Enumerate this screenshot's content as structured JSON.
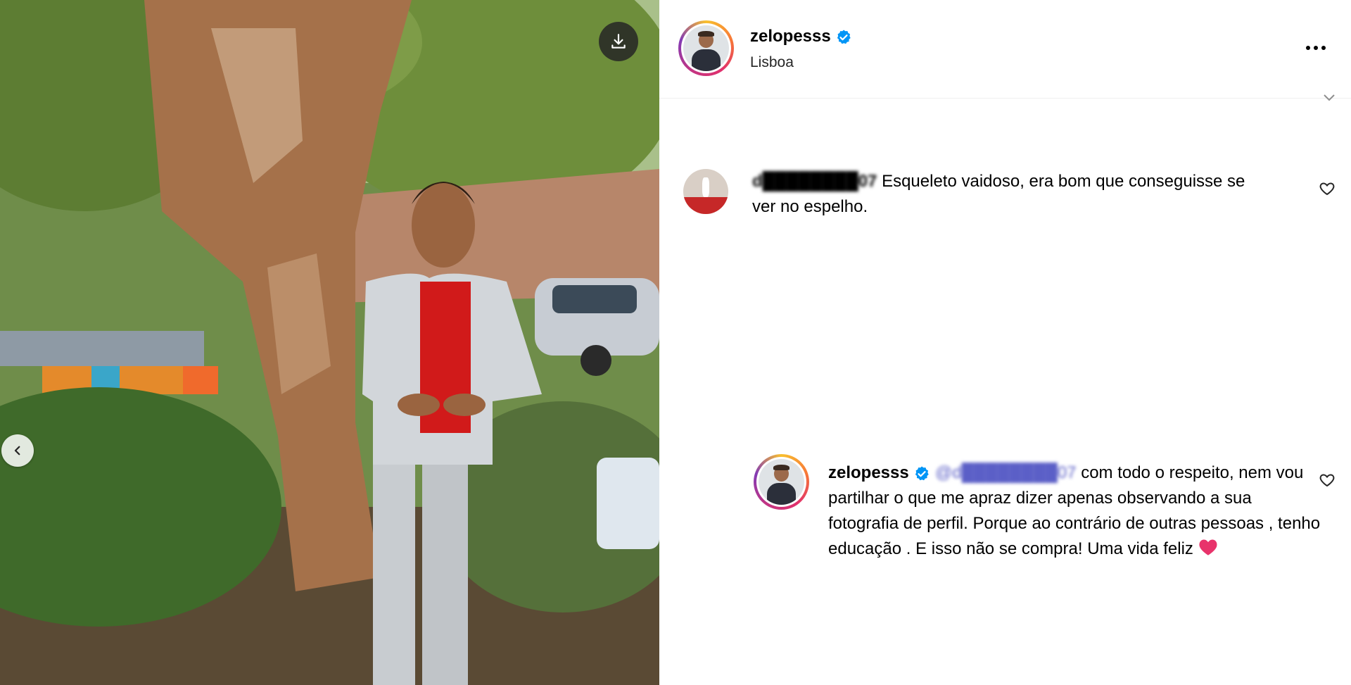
{
  "media": {
    "download_icon": "download-icon",
    "prev_icon": "chevron-left-icon"
  },
  "post": {
    "username": "zelopesss",
    "verified": true,
    "location": "Lisboa",
    "more_icon": "more-options-icon"
  },
  "comments": [
    {
      "username": "d████████07",
      "username_visible_tail": "07",
      "text": "Esqueleto vaidoso, era bom que conseguisse se ver no espelho.",
      "like_icon": "heart-icon"
    },
    {
      "username": "zelopesss",
      "verified": true,
      "mention": "@d████████07",
      "text": "com todo o respeito, nem vou partilhar o que me apraz dizer apenas observando a sua fotografia de perfil. Porque ao contrário de outras pessoas , tenho educação . E isso não se compra! Uma vida feliz",
      "emoji": "heart-emoji",
      "like_icon": "heart-icon"
    }
  ],
  "colors": {
    "accent_blue": "#0095f6",
    "mention": "#5b5fc7",
    "heart_emoji": "#e8336b"
  }
}
